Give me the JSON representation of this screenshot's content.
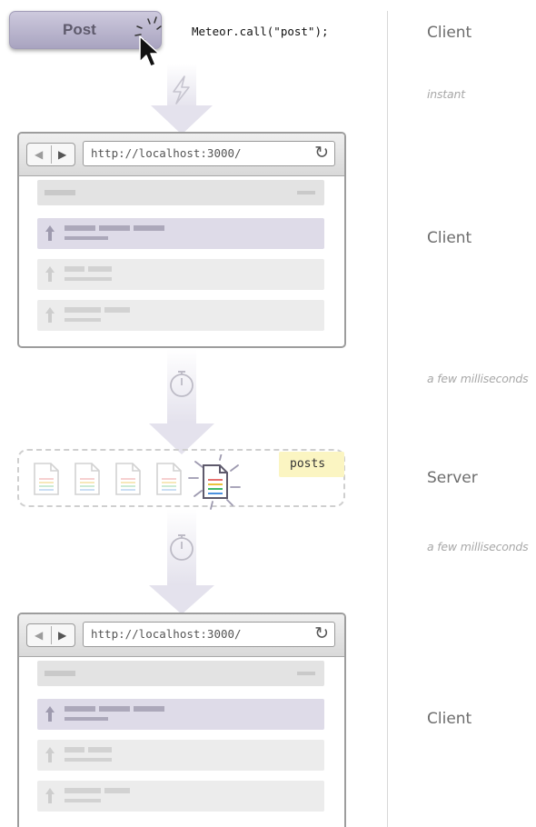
{
  "post_button": {
    "label": "Post"
  },
  "code": {
    "call": "Meteor.call(\"post\");"
  },
  "browser": {
    "url": "http://localhost:3000/",
    "back_icon": "back-icon",
    "forward_icon": "forward-icon",
    "reload_icon": "reload-icon"
  },
  "collection": {
    "name": "posts"
  },
  "stages": [
    {
      "label": "Client"
    },
    {
      "label": "Client"
    },
    {
      "label": "Server"
    },
    {
      "label": "Client"
    }
  ],
  "timings": [
    {
      "label": "instant"
    },
    {
      "label": "a few milliseconds"
    },
    {
      "label": "a few milliseconds"
    }
  ],
  "icons": {
    "flash": "lightning-icon",
    "timer": "stopwatch-icon",
    "cursor": "mouse-pointer-icon",
    "document": "document-icon"
  },
  "colors": {
    "highlight": "#dedbe8",
    "arrow": "#e4e2ed",
    "tag": "#fbf5c2"
  }
}
